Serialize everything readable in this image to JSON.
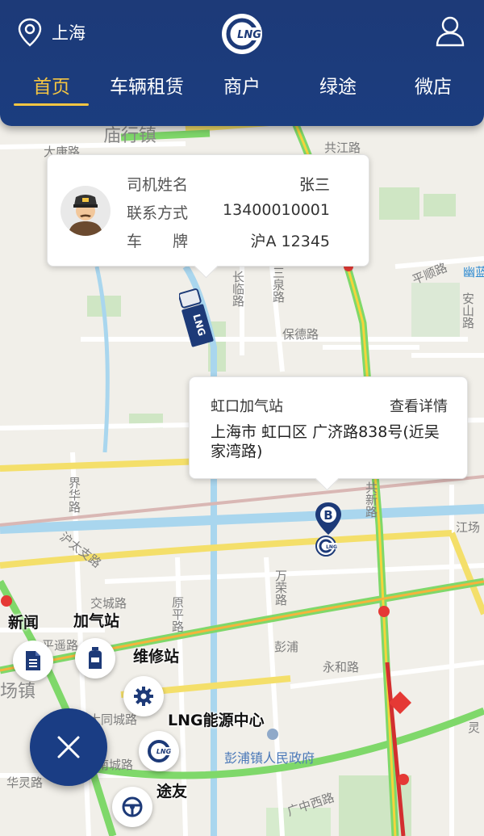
{
  "header": {
    "location": "上海",
    "tabs": [
      {
        "label": "首页",
        "active": true
      },
      {
        "label": "车辆租赁",
        "active": false
      },
      {
        "label": "商户",
        "active": false
      },
      {
        "label": "绿途",
        "active": false
      },
      {
        "label": "微店",
        "active": false
      }
    ],
    "accent_color": "#f4c542",
    "bar_color": "#1d3a78"
  },
  "driver_card": {
    "rows": [
      {
        "label": "司机姓名",
        "value": "张三"
      },
      {
        "label": "联系方式",
        "value": "13400010001"
      },
      {
        "label": "车　　牌",
        "value": "沪A 12345"
      }
    ]
  },
  "truck_label": "LNG",
  "station_card": {
    "name": "虹口加气站",
    "detail_link": "查看详情",
    "address": "上海市  虹口区  广济路838号(近吴家湾路)"
  },
  "marker_letter": "B",
  "map_labels": {
    "town_top": "庙行镇",
    "dachang": "大康路",
    "gongjiang": "共江路",
    "changlin": "长临路",
    "sanquan": "三泉路",
    "pingshun": "平顺路",
    "baode": "保德路",
    "anshan": "安山路",
    "metro": "幽蓝",
    "jiezhi": "界华路",
    "hudaguo": "沪太支路",
    "gongxin": "共新路",
    "jiangchang": "江场",
    "jiaocheng": "交城路",
    "yuanping": "原平路",
    "wanrong": "万荣路",
    "pengpu": "彭浦",
    "yonghe": "永和路",
    "pingyao": "平遥路",
    "town_left": "场镇",
    "datong": "大同城路",
    "nanyi": "南城路",
    "hualing": "华灵路",
    "gov": "彭浦镇人民政府",
    "guangzhong": "广中西路",
    "ling": "灵"
  },
  "fab_menu": {
    "news": "新闻",
    "gas_station": "加气站",
    "repair": "维修站",
    "lng_center": "LNG能源中心",
    "friends": "途友",
    "close_icon": "close-icon"
  }
}
